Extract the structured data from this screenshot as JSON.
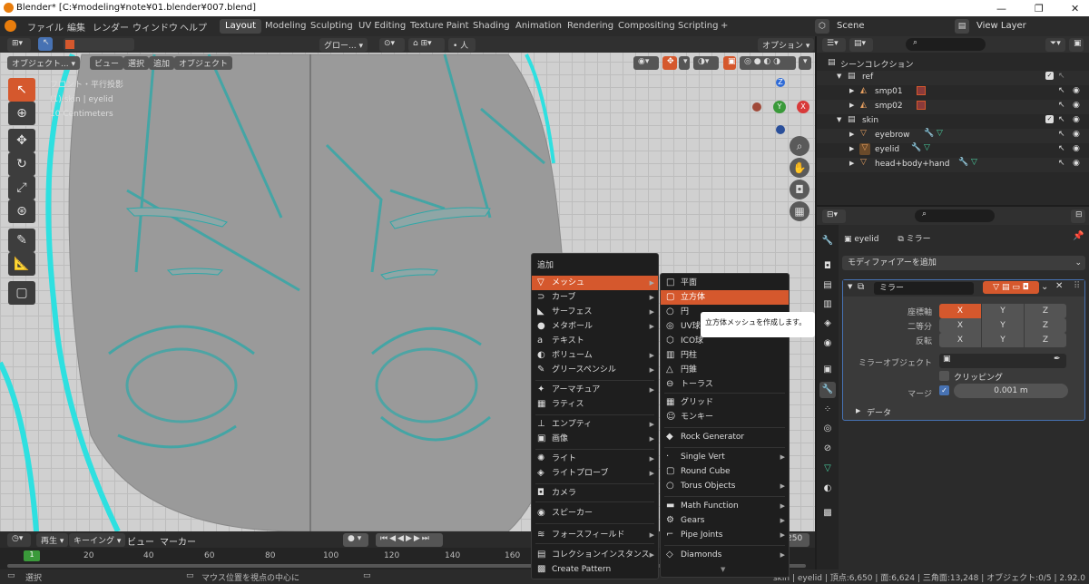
{
  "window": {
    "title": "Blender* [C:¥modeling¥note¥01.blender¥007.blend]",
    "min": "—",
    "max": "❐",
    "close": "✕"
  },
  "menubar": {
    "file": "ファイル",
    "edit": "編集",
    "render": "レンダー",
    "window": "ウィンドウ",
    "help": "ヘルプ"
  },
  "workspaces": [
    "Layout",
    "Modeling",
    "Sculpting",
    "UV Editing",
    "Texture Paint",
    "Shading",
    "Animation",
    "Rendering",
    "Compositing",
    "Scripting"
  ],
  "workspace_add": "+",
  "scene": "Scene",
  "view_layer": "View Layer",
  "header": {
    "transform": "グロー...",
    "options": "オプション"
  },
  "viewport_header": {
    "mode": "オブジェクト...",
    "view": "ビュー",
    "select": "選択",
    "add": "追加",
    "object": "オブジェクト"
  },
  "overlay": {
    "line1": "フロント・平行投影",
    "line2": "(1) skin | eyelid",
    "line3": "10 Centimeters"
  },
  "gizmo": {
    "z": "Z",
    "y": "Y",
    "x": "X"
  },
  "timeline": {
    "playback": "再生",
    "keying": "キーイング",
    "view": "ビュー",
    "marker": "マーカー",
    "current": "1",
    "frames": [
      "20",
      "40",
      "60",
      "80",
      "100",
      "120",
      "140",
      "160"
    ],
    "end": "250"
  },
  "status": {
    "left": "選択",
    "mid": "マウス位置を視点の中心に",
    "right": "skin | eyelid | 頂点:6,650 | 面:6,624 | 三角面:13,248 | オブジェクト:0/5 | 2.92.0"
  },
  "outliner": {
    "root": "シーンコレクション",
    "items": [
      {
        "name": "ref",
        "depth": 1
      },
      {
        "name": "smp01",
        "depth": 2
      },
      {
        "name": "smp02",
        "depth": 2
      },
      {
        "name": "skin",
        "depth": 1
      },
      {
        "name": "eyebrow",
        "depth": 2
      },
      {
        "name": "eyelid",
        "depth": 2
      },
      {
        "name": "head+body+hand",
        "depth": 2
      }
    ]
  },
  "properties": {
    "object": "eyelid",
    "modifier_name": "ミラー",
    "add_modifier": "モディファイアーを追加",
    "panel_name": "ミラー",
    "axis_label": "座標軸",
    "bisect_label": "二等分",
    "flip_label": "反転",
    "x": "X",
    "y": "Y",
    "z": "Z",
    "mirror_object_label": "ミラーオブジェクト",
    "clipping": "クリッピング",
    "merge_label": "マージ",
    "merge_value": "0.001 m",
    "data": "データ"
  },
  "menu_add": {
    "title": "追加",
    "items": [
      {
        "label": "メッシュ",
        "icon": "▽",
        "sub": true,
        "hl": true
      },
      {
        "label": "カーブ",
        "icon": "⊃",
        "sub": true
      },
      {
        "label": "サーフェス",
        "icon": "◣",
        "sub": true
      },
      {
        "label": "メタボール",
        "icon": "●",
        "sub": true
      },
      {
        "label": "テキスト",
        "icon": "a",
        "sub": false
      },
      {
        "label": "ボリューム",
        "icon": "◐",
        "sub": true
      },
      {
        "label": "グリースペンシル",
        "icon": "✎",
        "sub": true
      },
      {
        "label": "アーマチュア",
        "icon": "✦",
        "sub": true
      },
      {
        "label": "ラティス",
        "icon": "▦",
        "sub": false
      },
      {
        "label": "エンプティ",
        "icon": "⊥",
        "sub": true
      },
      {
        "label": "画像",
        "icon": "▣",
        "sub": true
      },
      {
        "label": "ライト",
        "icon": "✺",
        "sub": true
      },
      {
        "label": "ライトプローブ",
        "icon": "◈",
        "sub": true
      },
      {
        "label": "カメラ",
        "icon": "◘",
        "sub": false
      },
      {
        "label": "スピーカー",
        "icon": "◉",
        "sub": false
      },
      {
        "label": "フォースフィールド",
        "icon": "≋",
        "sub": true
      },
      {
        "label": "コレクションインスタンス",
        "icon": "▤",
        "sub": true
      },
      {
        "label": "Create Pattern",
        "icon": "▩",
        "sub": false
      }
    ]
  },
  "menu_mesh": {
    "items": [
      {
        "label": "平面",
        "icon": "□"
      },
      {
        "label": "立方体",
        "icon": "▢",
        "hl": true
      },
      {
        "label": "円",
        "icon": "○"
      },
      {
        "label": "UV球",
        "icon": "◎"
      },
      {
        "label": "ICO球",
        "icon": "⬡"
      },
      {
        "label": "円柱",
        "icon": "▥"
      },
      {
        "label": "円錐",
        "icon": "△"
      },
      {
        "label": "トーラス",
        "icon": "⊖"
      },
      {
        "label": "グリッド",
        "icon": "▦"
      },
      {
        "label": "モンキー",
        "icon": "☺"
      },
      {
        "label": "Rock Generator",
        "icon": "◆"
      },
      {
        "label": "Single Vert",
        "icon": "·",
        "sub": true
      },
      {
        "label": "Round Cube",
        "icon": "▢"
      },
      {
        "label": "Torus Objects",
        "icon": "○",
        "sub": true
      },
      {
        "label": "Math Function",
        "icon": "▬",
        "sub": true
      },
      {
        "label": "Gears",
        "icon": "⚙",
        "sub": true
      },
      {
        "label": "Pipe Joints",
        "icon": "⌐",
        "sub": true
      },
      {
        "label": "Diamonds",
        "icon": "◇",
        "sub": true
      }
    ],
    "more": "▼"
  },
  "tooltip": "立方体メッシュを作成します。"
}
